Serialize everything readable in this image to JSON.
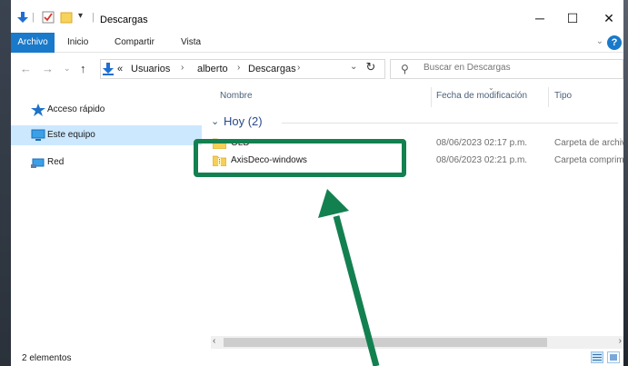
{
  "window": {
    "title": "Descargas",
    "minimize": "─",
    "maximize": "☐",
    "close": "✕"
  },
  "ribbon": {
    "tabs": [
      "Archivo",
      "Inicio",
      "Compartir",
      "Vista"
    ],
    "help": "?"
  },
  "address": {
    "overflow": "«",
    "crumbs": [
      "Usuarios",
      "alberto",
      "Descargas"
    ],
    "search_placeholder": "Buscar en Descargas"
  },
  "nav": {
    "items": [
      {
        "label": "Acceso rápido",
        "icon": "star-icon"
      },
      {
        "label": "Este equipo",
        "icon": "computer-icon",
        "selected": true
      },
      {
        "label": "Red",
        "icon": "network-icon"
      }
    ]
  },
  "columns": {
    "name": "Nombre",
    "date": "Fecha de modificación",
    "type": "Tipo"
  },
  "group": {
    "label": "Hoy (2)"
  },
  "files": [
    {
      "name": "OLD",
      "date": "08/06/2023 02:17 p.m.",
      "type": "Carpeta de archivos",
      "icon": "folder-icon"
    },
    {
      "name": "AxisDeco-windows",
      "date": "08/06/2023 02:21 p.m.",
      "type": "Carpeta comprimida",
      "icon": "zip-folder-icon"
    }
  ],
  "status": {
    "count": "2 elementos"
  },
  "colors": {
    "accent": "#1979ca",
    "annotation": "#138050",
    "selection": "#cce8ff"
  }
}
